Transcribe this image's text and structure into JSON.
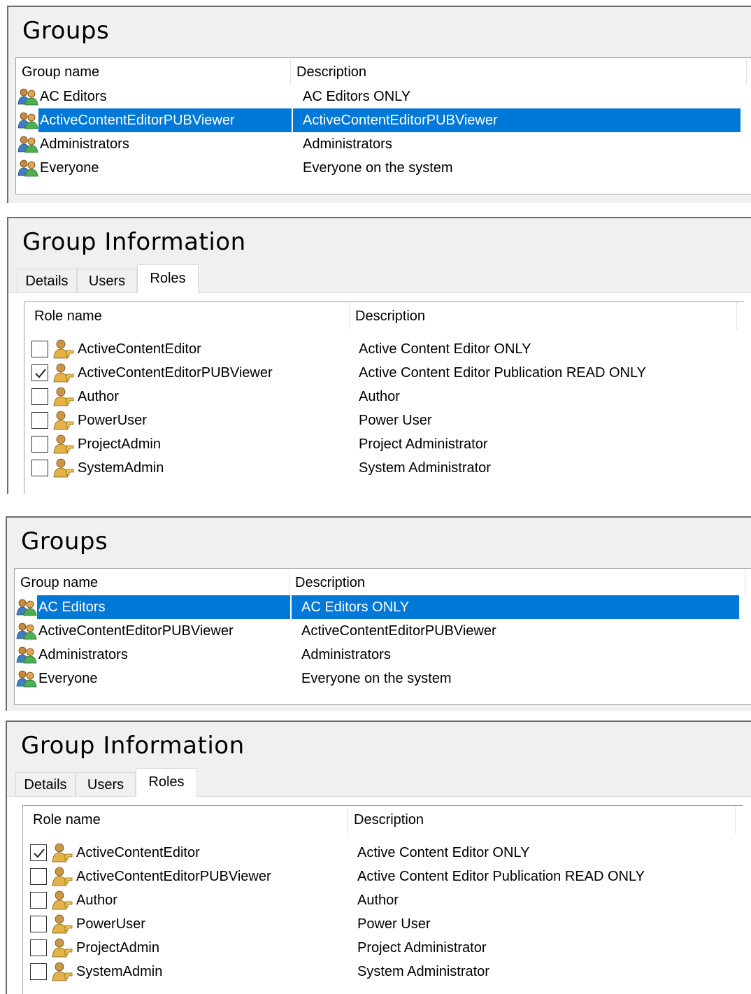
{
  "screens": [
    {
      "groups": {
        "title": "Groups",
        "columns": {
          "name": "Group name",
          "description": "Description"
        },
        "rows": [
          {
            "name": "AC Editors",
            "description": "AC Editors ONLY",
            "selected": false
          },
          {
            "name": "ActiveContentEditorPUBViewer",
            "description": "ActiveContentEditorPUBViewer",
            "selected": true
          },
          {
            "name": "Administrators",
            "description": "Administrators",
            "selected": false
          },
          {
            "name": "Everyone",
            "description": "Everyone on the system",
            "selected": false
          }
        ]
      },
      "info": {
        "title": "Group Information",
        "tabs": [
          "Details",
          "Users",
          "Roles"
        ],
        "active_tab": "Roles",
        "columns": {
          "name": "Role name",
          "description": "Description"
        },
        "roles": [
          {
            "name": "ActiveContentEditor",
            "description": "Active Content Editor ONLY",
            "checked": false
          },
          {
            "name": "ActiveContentEditorPUBViewer",
            "description": "Active Content Editor Publication READ ONLY",
            "checked": true
          },
          {
            "name": "Author",
            "description": "Author",
            "checked": false
          },
          {
            "name": "PowerUser",
            "description": "Power User",
            "checked": false
          },
          {
            "name": "ProjectAdmin",
            "description": "Project Administrator",
            "checked": false
          },
          {
            "name": "SystemAdmin",
            "description": "System Administrator",
            "checked": false
          }
        ]
      }
    },
    {
      "groups": {
        "title": "Groups",
        "columns": {
          "name": "Group name",
          "description": "Description"
        },
        "rows": [
          {
            "name": "AC Editors",
            "description": "AC Editors ONLY",
            "selected": true
          },
          {
            "name": "ActiveContentEditorPUBViewer",
            "description": "ActiveContentEditorPUBViewer",
            "selected": false
          },
          {
            "name": "Administrators",
            "description": "Administrators",
            "selected": false
          },
          {
            "name": "Everyone",
            "description": "Everyone on the system",
            "selected": false
          }
        ]
      },
      "info": {
        "title": "Group Information",
        "tabs": [
          "Details",
          "Users",
          "Roles"
        ],
        "active_tab": "Roles",
        "columns": {
          "name": "Role name",
          "description": "Description"
        },
        "roles": [
          {
            "name": "ActiveContentEditor",
            "description": "Active Content Editor ONLY",
            "checked": true
          },
          {
            "name": "ActiveContentEditorPUBViewer",
            "description": "Active Content Editor Publication READ ONLY",
            "checked": false
          },
          {
            "name": "Author",
            "description": "Author",
            "checked": false
          },
          {
            "name": "PowerUser",
            "description": "Power User",
            "checked": false
          },
          {
            "name": "ProjectAdmin",
            "description": "Project Administrator",
            "checked": false
          },
          {
            "name": "SystemAdmin",
            "description": "System Administrator",
            "checked": false
          }
        ]
      }
    }
  ],
  "icons": {
    "group": "group-users-icon",
    "role": "role-user-icon",
    "check": "checkmark-icon"
  },
  "colors": {
    "selection": "#0078d7",
    "panel_bg": "#f0f0f0",
    "border": "#6d6d6d"
  }
}
